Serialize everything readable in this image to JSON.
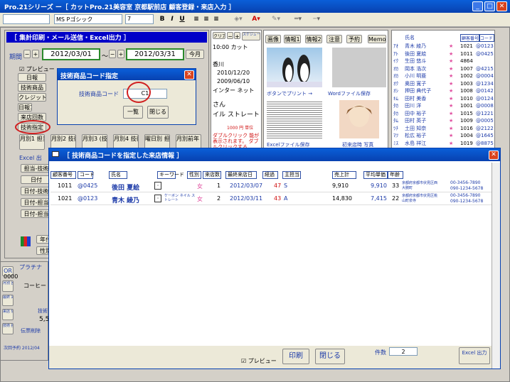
{
  "window": {
    "title": "Pro.21シリーズ ー［ カットPro.21美容室 京都駅前店 顧客登録・来店入力 ］"
  },
  "toolbar": {
    "font": "MS Pゴシック",
    "size": "7",
    "bold": "B",
    "italic": "I",
    "underline": "U"
  },
  "summary": {
    "header": "［ 集計印刷・メール送信・Excel出力 ］",
    "period_label": "期間",
    "date_from": "2012/03/01",
    "tilde": "～",
    "date_to": "2012/03/31",
    "this_month": "今月",
    "preview": "プレビュー",
    "left_buttons": [
      "日報",
      "技術商品",
      "クレジット",
      "日報1",
      "来店回数",
      "技術指定"
    ],
    "bottom_buttons": [
      "月別1 担当コード",
      "月別2 技術区分",
      "月別3 (技術のみ)",
      "月別4 技術コード",
      "曜日別 担当コード",
      "月別前年 対比"
    ],
    "excel_header": "Excel 出",
    "excel_buttons": [
      "担当-技術",
      "日付",
      "日付-技術",
      "日付-担当",
      "日付-担当"
    ],
    "year": "年代",
    "gender": "性別"
  },
  "center": {
    "clear": "クリア",
    "schedule": "スケジュール 登録",
    "time_menu": "10:00 カット",
    "store": "香川",
    "date1": "2010/12/20",
    "date2": "2009/06/10",
    "channel": "インター ネット",
    "san": "さん",
    "style": "イル ストレート",
    "price": "1000 円 単位",
    "dblclick": "ダブルクリック 能が表示されます。 ダブルクリックする"
  },
  "image_tabs": [
    "画像",
    "情報1",
    "情報2",
    "注意",
    "予約",
    "Memo"
  ],
  "image_panel": {
    "print_btn": "ボタンでプリント →",
    "word_btn": "Wordファイル保存",
    "excel_btn": "Excelファイル保存",
    "first_photo": "初来店時 写真"
  },
  "customers": {
    "header_name": "氏名",
    "header_no": "顧客番号",
    "header_code": "コード",
    "rows": [
      {
        "kana": "ｱｵ",
        "name": "青木 綾乃",
        "star": "★",
        "no": "1021",
        "code": "@0123"
      },
      {
        "kana": "ｱﾄ",
        "name": "後田 夏絵",
        "star": "★",
        "no": "1011",
        "code": "@0425"
      },
      {
        "kana": "ｲｸ",
        "name": "生田 悠斗",
        "star": "★",
        "no": "4864",
        "code": ""
      },
      {
        "kana": "ｵｶ",
        "name": "岡本 浩次",
        "star": "★",
        "no": "1007",
        "code": "@4215"
      },
      {
        "kana": "ｵｶ",
        "name": "小川 明亜",
        "star": "★",
        "no": "1002",
        "code": "@0004"
      },
      {
        "kana": "ｵｸ",
        "name": "奥田 寛子",
        "star": "★",
        "no": "1003",
        "code": "@1234"
      },
      {
        "kana": "ｵｼ",
        "name": "押田 典代子",
        "star": "★",
        "no": "1008",
        "code": "@0142"
      },
      {
        "kana": "ｷﾑ",
        "name": "田村 美香",
        "star": "★",
        "no": "1010",
        "code": "@0124"
      },
      {
        "kana": "ﾀｶ",
        "name": "田川 洋",
        "star": "★",
        "no": "1001",
        "code": "@0008"
      },
      {
        "kana": "ﾀｶ",
        "name": "田中 裕子",
        "star": "★",
        "no": "1015",
        "code": "@1221"
      },
      {
        "kana": "ﾀﾑ",
        "name": "田村 英子",
        "star": "★",
        "no": "1009",
        "code": "@0005"
      },
      {
        "kana": "ﾂﾁ",
        "name": "土田 知奈",
        "star": "★",
        "no": "1016",
        "code": "@2122"
      },
      {
        "kana": "ﾏﾂ",
        "name": "松広 裕子",
        "star": "★",
        "no": "1004",
        "code": "@1645"
      },
      {
        "kana": "ﾐｽ",
        "name": "水島 祥江",
        "star": "★",
        "no": "1019",
        "code": "@8875"
      }
    ]
  },
  "dialog_code": {
    "title": "技術商品コード指定",
    "label": "技術商品コード",
    "value": "C1",
    "list_btn": "一覧",
    "close_btn": "閉じる"
  },
  "result": {
    "title": "［ 技術商品コードを指定した来店情報 ］",
    "headers": [
      "顧客番号",
      "コード",
      "氏名",
      "キーワード",
      "性別",
      "来店数",
      "最終来店日",
      "経過",
      "主担当",
      "売上計",
      "平均単価",
      "年齢"
    ],
    "rows": [
      {
        "no": "1011",
        "code": "@0425",
        "name": "後田 夏絵",
        "keyword": "",
        "sex": "女",
        "visits": "1",
        "last": "2012/03/07",
        "elapsed": "47",
        "unit": "S",
        "sales": "9,910",
        "avg": "9,910",
        "age": "33",
        "addr1": "京都府京都市伏見区西",
        "addr2": "大腕町",
        "tel1": "00-3456-7890",
        "tel2": "090-1234-5678"
      },
      {
        "no": "1021",
        "code": "@0123",
        "name": "青木 綾乃",
        "keyword": "ケーボン ネイル ストレート",
        "sex": "女",
        "visits": "2",
        "last": "2012/03/11",
        "elapsed": "43",
        "unit": "A",
        "sales": "14,830",
        "avg": "7,415",
        "age": "22",
        "addr1": "京都府京都市伏見区桃",
        "addr2": "山町泉寺",
        "tel1": "00-3456-7890",
        "tel2": "090-1234-5678"
      }
    ],
    "preview": "プレビュー",
    "print": "印刷",
    "close": "閉じる",
    "count_label": "件数",
    "count": "2",
    "excel": "Excel 出力"
  },
  "lower_left": {
    "or": "OR",
    "num": "0000",
    "coffee": "コーヒー",
    "platinum": "プラチナ",
    "side_labels": [
      "月別 回数",
      "最終 来店",
      "来店 情報",
      "技術 担当"
    ],
    "tech": "技術",
    "val": "5,5",
    "delete": "伝票削除",
    "next": "次回予約 2012/04"
  }
}
